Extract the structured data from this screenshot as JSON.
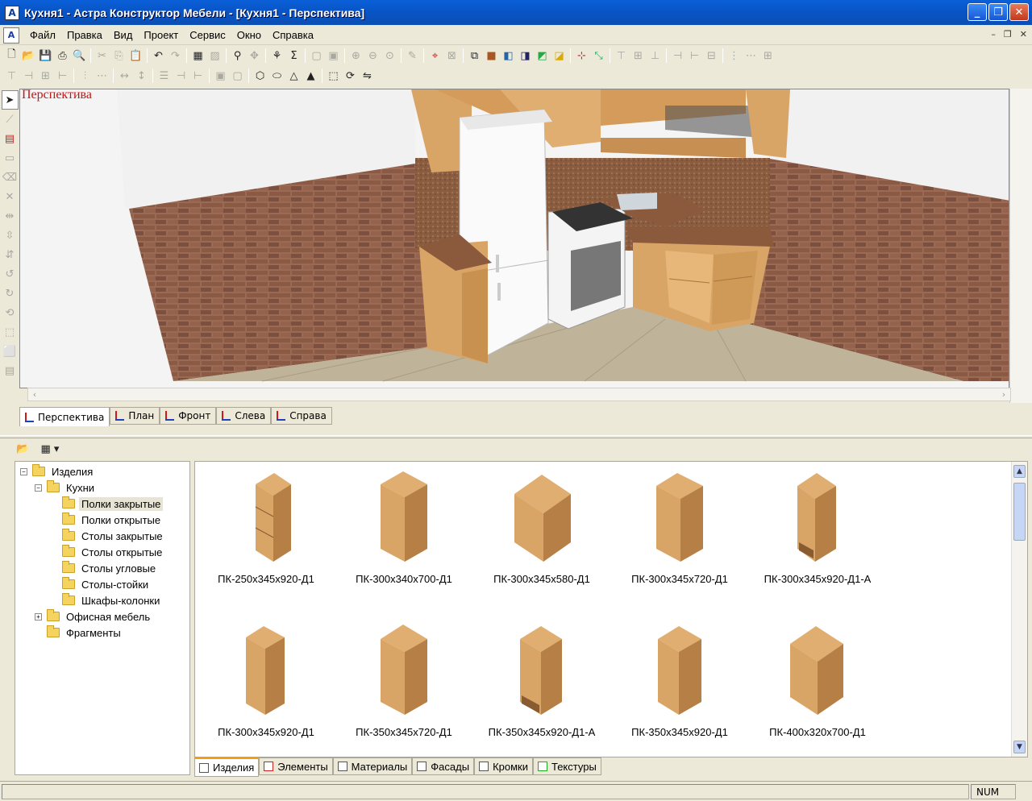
{
  "window": {
    "title": "Кухня1 - Астра Конструктор Мебели - [Кухня1 - Перспектива]",
    "app_icon_text": "A"
  },
  "menu": [
    "Файл",
    "Правка",
    "Вид",
    "Проект",
    "Сервис",
    "Окно",
    "Справка"
  ],
  "viewport": {
    "label": "Перспектива",
    "colors": {
      "brick": "#8a5a45",
      "wood": "#d9a567",
      "floor": "#b9ad92",
      "wall": "#f2f2f2"
    }
  },
  "view_tabs": [
    "Перспектива",
    "План",
    "Фронт",
    "Слева",
    "Справа"
  ],
  "tree": {
    "root": "Изделия",
    "kitchen": "Кухни",
    "kitchen_children": [
      "Полки закрытые",
      "Полки открытые",
      "Столы закрытые",
      "Столы открытые",
      "Столы угловые",
      "Столы-стойки",
      "Шкафы-колонки"
    ],
    "office": "Офисная мебель",
    "fragments": "Фрагменты"
  },
  "catalog": {
    "items": [
      "ПК-250x345x920-Д1",
      "ПК-300x340x700-Д1",
      "ПК-300x345x580-Д1",
      "ПК-300x345x720-Д1",
      "ПК-300x345x920-Д1-А",
      "ПК-300x345x920-Д1",
      "ПК-350x345x720-Д1",
      "ПК-350x345x920-Д1-А",
      "ПК-350x345x920-Д1",
      "ПК-400x320x700-Д1"
    ]
  },
  "library_tabs": [
    "Изделия",
    "Элементы",
    "Материалы",
    "Фасады",
    "Кромки",
    "Текстуры"
  ],
  "status": {
    "num": "NUM"
  }
}
